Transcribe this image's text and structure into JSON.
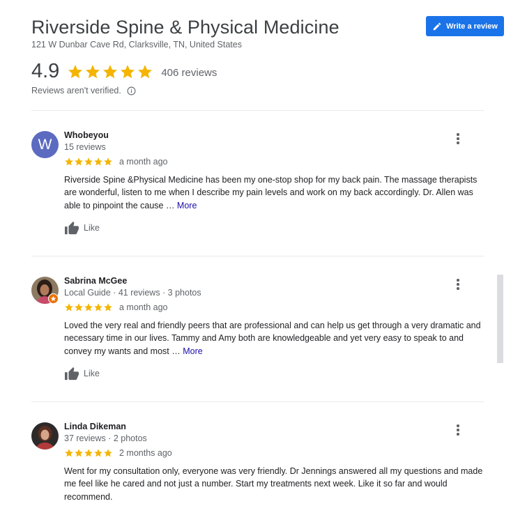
{
  "business": {
    "name": "Riverside Spine & Physical Medicine",
    "address": "121 W Dunbar Cave Rd, Clarksville, TN, United States",
    "rating": "4.9",
    "review_count": "406 reviews",
    "unverified_note": "Reviews aren't verified."
  },
  "write_review": {
    "label": "Write a review"
  },
  "colors": {
    "star": "#f4b400",
    "button": "#1a73e8",
    "link": "#1a0dab",
    "avatar_w": "#5c6bc0"
  },
  "reviews": [
    {
      "name": "Whobeyou",
      "meta": "15 reviews",
      "avatar_letter": "W",
      "stars": 5,
      "date": "a month ago",
      "text": "Riverside Spine &Physical Medicine has been my one-stop shop for my back pain.   The massage therapists are wonderful,  listen to me when I describe my pain levels and work on my back accordingly.  Dr. Allen was able to pinpoint the cause … ",
      "more": "More",
      "like": "Like"
    },
    {
      "name": "Sabrina McGee",
      "meta": "Local Guide · 41 reviews · 3 photos",
      "stars": 5,
      "date": "a month ago",
      "text": "Loved the very real and friendly peers that are professional and can help us get through a very dramatic and necessary time in our lives. Tammy and Amy both are knowledgeable and yet very easy to speak to and convey my wants and most … ",
      "more": "More",
      "like": "Like"
    },
    {
      "name": "Linda Dikeman",
      "meta": "37 reviews · 2 photos",
      "stars": 5,
      "date": "2 months ago",
      "text": "Went for my consultation only, everyone was very friendly. Dr  Jennings answered all my questions and made me feel like he cared and not just a number. Start my treatments next week. Like it so far and would recommend."
    }
  ]
}
